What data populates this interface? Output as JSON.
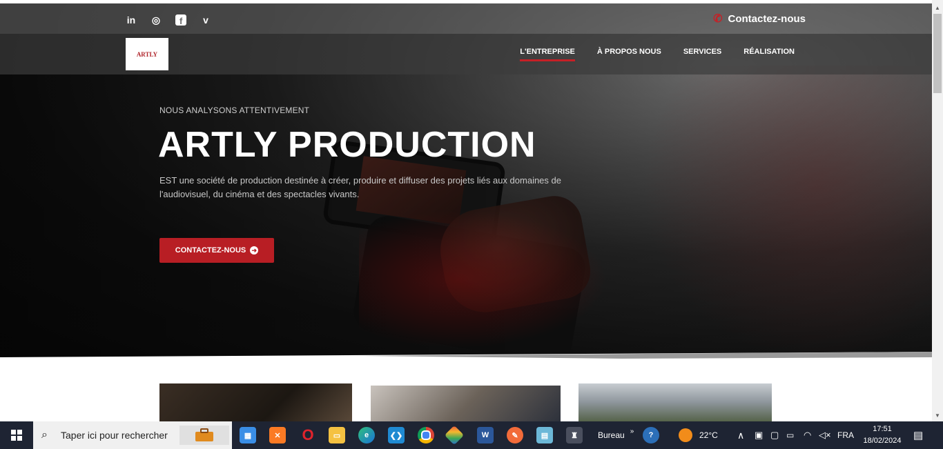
{
  "social": {
    "linkedin": "in",
    "instagram": "◎",
    "facebook": "f",
    "vimeo": "v"
  },
  "header": {
    "contact_label": "Contactez-nous"
  },
  "logo": {
    "text": "ARTLY"
  },
  "nav": {
    "items": [
      {
        "label": "L'ENTREPRISE",
        "active": true
      },
      {
        "label": "À PROPOS NOUS",
        "active": false
      },
      {
        "label": "SERVICES",
        "active": false
      },
      {
        "label": "RÉALISATION",
        "active": false
      }
    ]
  },
  "hero": {
    "kicker": "NOUS ANALYSONS ATTENTIVEMENT",
    "title": "ARTLY PRODUCTION",
    "description": "EST une société de production destinée à créer, produire et diffuser des projets liés aux domaines de l'audiovisuel, du cinéma et des spectacles vivants.",
    "cta_label": "CONTACTEZ-NOUS"
  },
  "colors": {
    "accent": "#c62026",
    "cta": "#b81e24",
    "taskbar": "#1e2433"
  },
  "taskbar": {
    "search_placeholder": "Taper ici pour rechercher",
    "desktop_label": "Bureau",
    "weather": "22°C",
    "language": "FRA",
    "time": "17:51",
    "date": "18/02/2024",
    "apps": [
      "windows-store",
      "xampp",
      "opera",
      "file-explorer",
      "edge",
      "vscode",
      "chrome",
      "sourcetree",
      "word",
      "pen-app",
      "notepad",
      "app-active"
    ]
  }
}
